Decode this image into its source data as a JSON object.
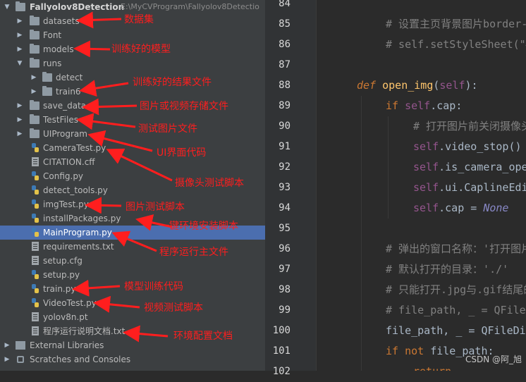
{
  "project": {
    "root_name": "Fallyolov8Detection",
    "root_path": "E:\\MyCVProgram\\Fallyolov8Detectio",
    "items": [
      {
        "label": "datasets",
        "icon": "folder-icon"
      },
      {
        "label": "Font",
        "icon": "folder-icon"
      },
      {
        "label": "models",
        "icon": "folder-icon"
      },
      {
        "label": "runs",
        "icon": "folder-icon"
      },
      {
        "label": "detect",
        "icon": "folder-icon"
      },
      {
        "label": "train6",
        "icon": "folder-icon"
      },
      {
        "label": "save_data",
        "icon": "folder-icon"
      },
      {
        "label": "TestFiles",
        "icon": "folder-icon"
      },
      {
        "label": "UIProgram",
        "icon": "folder-icon"
      },
      {
        "label": "CameraTest.py",
        "icon": "python-file-icon"
      },
      {
        "label": "CITATION.cff",
        "icon": "text-file-icon"
      },
      {
        "label": "Config.py",
        "icon": "python-file-icon"
      },
      {
        "label": "detect_tools.py",
        "icon": "python-file-icon"
      },
      {
        "label": "imgTest.py",
        "icon": "python-file-icon"
      },
      {
        "label": "installPackages.py",
        "icon": "python-file-icon"
      },
      {
        "label": "MainProgram.py",
        "icon": "python-file-icon"
      },
      {
        "label": "requirements.txt",
        "icon": "text-file-icon"
      },
      {
        "label": "setup.cfg",
        "icon": "text-file-icon"
      },
      {
        "label": "setup.py",
        "icon": "python-file-icon"
      },
      {
        "label": "train.py",
        "icon": "python-file-icon"
      },
      {
        "label": "VideoTest.py",
        "icon": "python-file-icon"
      },
      {
        "label": "yolov8n.pt",
        "icon": "text-file-icon"
      },
      {
        "label": "程序运行说明文档.txt",
        "icon": "text-file-icon"
      }
    ],
    "external_libraries": "External Libraries",
    "scratches": "Scratches and Consoles"
  },
  "annotations": [
    "数据集",
    "训练好的模型",
    "训练好的结果文件",
    "图片或视频存储文件",
    "测试图片文件",
    "UI界面代码",
    "摄像头测试脚本",
    "图片测试脚本",
    "一键环境安装脚本",
    "程序运行主文件",
    "模型训练代码",
    "视频测试脚本",
    "环境配置文档"
  ],
  "editor": {
    "line_numbers": [
      "84",
      "85",
      "86",
      "87",
      "88",
      "89",
      "90",
      "91",
      "92",
      "93",
      "94",
      "95",
      "96",
      "97",
      "98",
      "99",
      "100",
      "101",
      "102"
    ]
  },
  "watermark": "CSDN @阿_旭",
  "colors": {
    "annotation": "#ff1e1e",
    "selection": "#4b6eaf",
    "keyword": "#cc7832",
    "function": "#ffc66d",
    "comment": "#808080"
  }
}
